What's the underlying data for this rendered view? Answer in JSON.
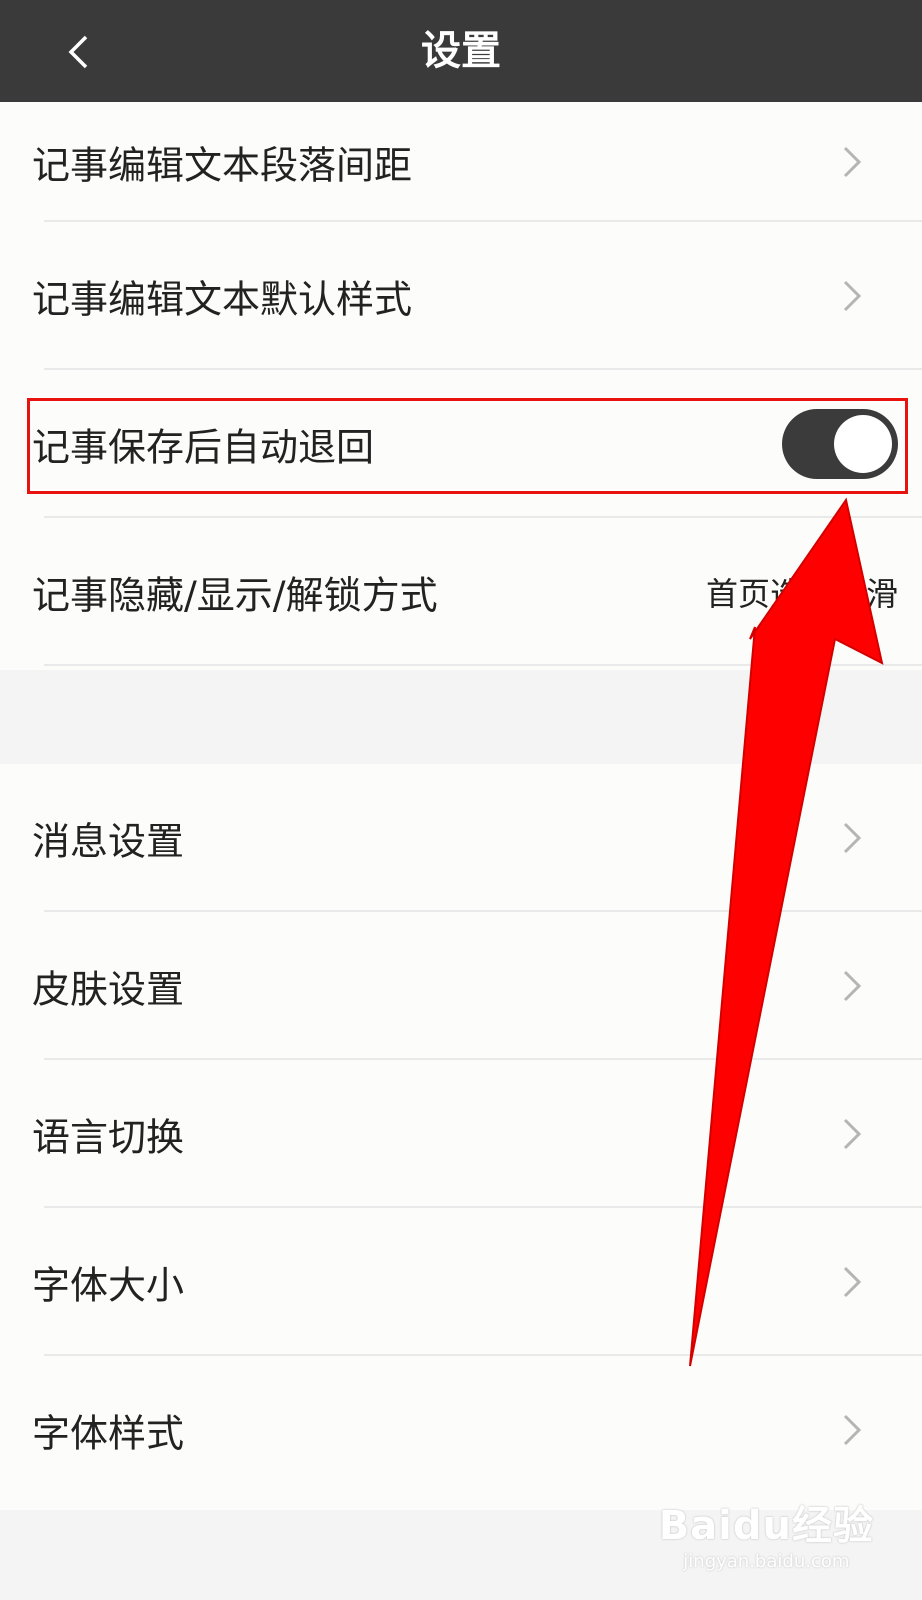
{
  "header": {
    "title": "设置",
    "back_icon": "chevron-left-icon"
  },
  "group1": {
    "rows": [
      {
        "label": "记事编辑文本段落间距",
        "type": "chevron"
      },
      {
        "label": "记事编辑文本默认样式",
        "type": "chevron"
      },
      {
        "label": "记事保存后自动退回",
        "type": "toggle",
        "toggle_on": true
      },
      {
        "label": "记事隐藏/显示/解锁方式",
        "type": "value",
        "value": "首页选项下滑"
      }
    ]
  },
  "group2": {
    "rows": [
      {
        "label": "消息设置",
        "type": "chevron"
      },
      {
        "label": "皮肤设置",
        "type": "chevron"
      },
      {
        "label": "语言切换",
        "type": "chevron"
      },
      {
        "label": "字体大小",
        "type": "chevron"
      },
      {
        "label": "字体样式",
        "type": "chevron"
      }
    ]
  },
  "annotation": {
    "highlight_color": "#e8120e",
    "arrow_color": "#ff0000"
  },
  "watermark": {
    "logo": "Baidu经验",
    "url": "jingyan.baidu.com"
  },
  "colors": {
    "header_bg": "#3a3a3a",
    "page_bg": "#f4f4f4",
    "row_bg": "#fcfcfa",
    "toggle_on": "#3b3b3b"
  }
}
